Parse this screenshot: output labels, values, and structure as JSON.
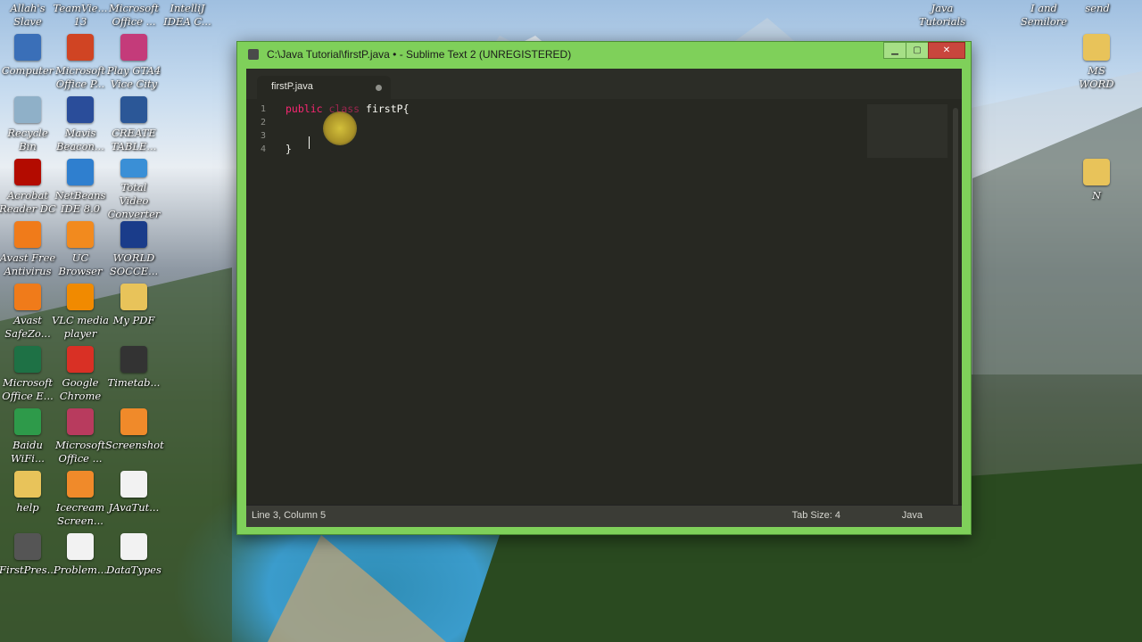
{
  "desktop": {
    "col1": [
      {
        "label": "Allah's\nSlave",
        "icon": "person-icon",
        "color": "#6a6a6a"
      },
      {
        "label": "Computer",
        "icon": "computer-icon",
        "color": "#3a6fb8"
      },
      {
        "label": "Recycle\nBin",
        "icon": "recycle-bin-icon",
        "color": "#8fb0c8"
      },
      {
        "label": "Acrobat\nReader DC",
        "icon": "acrobat-icon",
        "color": "#b30b00"
      },
      {
        "label": "Avast Free\nAntivirus",
        "icon": "avast-icon",
        "color": "#f07b1a"
      },
      {
        "label": "Avast\nSafeZo...",
        "icon": "avast-safezone-icon",
        "color": "#f07b1a"
      },
      {
        "label": "Microsoft\nOffice E...",
        "icon": "excel-icon",
        "color": "#1e7145"
      },
      {
        "label": "Baidu\nWiFi...",
        "icon": "baidu-wifi-icon",
        "color": "#2e9a4a"
      },
      {
        "label": "help",
        "icon": "folder-icon",
        "color": "#e8c35a"
      },
      {
        "label": "FirstPres...",
        "icon": "video-file-icon",
        "color": "#555555"
      }
    ],
    "col2": [
      {
        "label": "TeamVie...\n13",
        "icon": "teamviewer-icon",
        "color": "#0e6fc7"
      },
      {
        "label": "Microsoft\nOffice P...",
        "icon": "powerpoint-icon",
        "color": "#d04423"
      },
      {
        "label": "Mavis\nBeacon...",
        "icon": "mavis-beacon-icon",
        "color": "#2a4d9a"
      },
      {
        "label": "NetBeans\nIDE 8.0",
        "icon": "netbeans-icon",
        "color": "#2f7fcf"
      },
      {
        "label": "UC\nBrowser",
        "icon": "uc-browser-icon",
        "color": "#f28a1e"
      },
      {
        "label": "VLC media\nplayer",
        "icon": "vlc-icon",
        "color": "#f18a00"
      },
      {
        "label": "Google\nChrome",
        "icon": "chrome-icon",
        "color": "#d93025"
      },
      {
        "label": "Microsoft\nOffice ...",
        "icon": "office-icon",
        "color": "#b83b5e"
      },
      {
        "label": "Icecream\nScreen...",
        "icon": "icecream-icon",
        "color": "#f08a2a"
      },
      {
        "label": "Problem...",
        "icon": "text-file-icon",
        "color": "#f2f2f2"
      }
    ],
    "col3": [
      {
        "label": "Microsoft\nOffice ...",
        "icon": "office-icon",
        "color": "#d04423"
      },
      {
        "label": "Play GTA4\nVice City",
        "icon": "gta-icon",
        "color": "#c43b7a"
      },
      {
        "label": "CREATE\nTABLE...",
        "icon": "document-icon",
        "color": "#2b5797"
      },
      {
        "label": "Total Video\nConverter",
        "icon": "video-converter-icon",
        "color": "#3a8fd6"
      },
      {
        "label": "WORLD\nSOCCE...",
        "icon": "soccer-icon",
        "color": "#1a3c8a"
      },
      {
        "label": "My PDF",
        "icon": "folder-icon",
        "color": "#e8c35a"
      },
      {
        "label": "Timetab...",
        "icon": "timetable-icon",
        "color": "#333333"
      },
      {
        "label": "Screenshot",
        "icon": "screenshot-icon",
        "color": "#f08a2a"
      },
      {
        "label": "JAvaTut...",
        "icon": "text-file-icon",
        "color": "#f2f2f2"
      },
      {
        "label": "DataTypes",
        "icon": "text-file-icon",
        "color": "#f2f2f2"
      }
    ],
    "col4_top": {
      "label": "IntelliJ\nIDEA C..."
    },
    "right": [
      {
        "label": "Java\nTutorials"
      },
      {
        "label": "I and\nSemilore"
      },
      {
        "label": "send"
      },
      {
        "label": "MS\nWORD",
        "icon": "folder-icon",
        "color": "#e8c35a"
      },
      {
        "label": "N",
        "icon": "folder-icon",
        "color": "#e8c35a"
      }
    ]
  },
  "window": {
    "title": "C:\\Java Tutorial\\firstP.java • - Sublime Text 2 (UNREGISTERED)",
    "tab_label": "firstP.java",
    "line_numbers": [
      "1",
      "2",
      "3",
      "4"
    ],
    "code": {
      "line1_kw1": "public",
      "line1_kw2": "class",
      "line1_rest": " firstP{",
      "line4": "}"
    },
    "status": {
      "position": "Line 3, Column 5",
      "tab_size": "Tab Size: 4",
      "syntax": "Java"
    }
  }
}
